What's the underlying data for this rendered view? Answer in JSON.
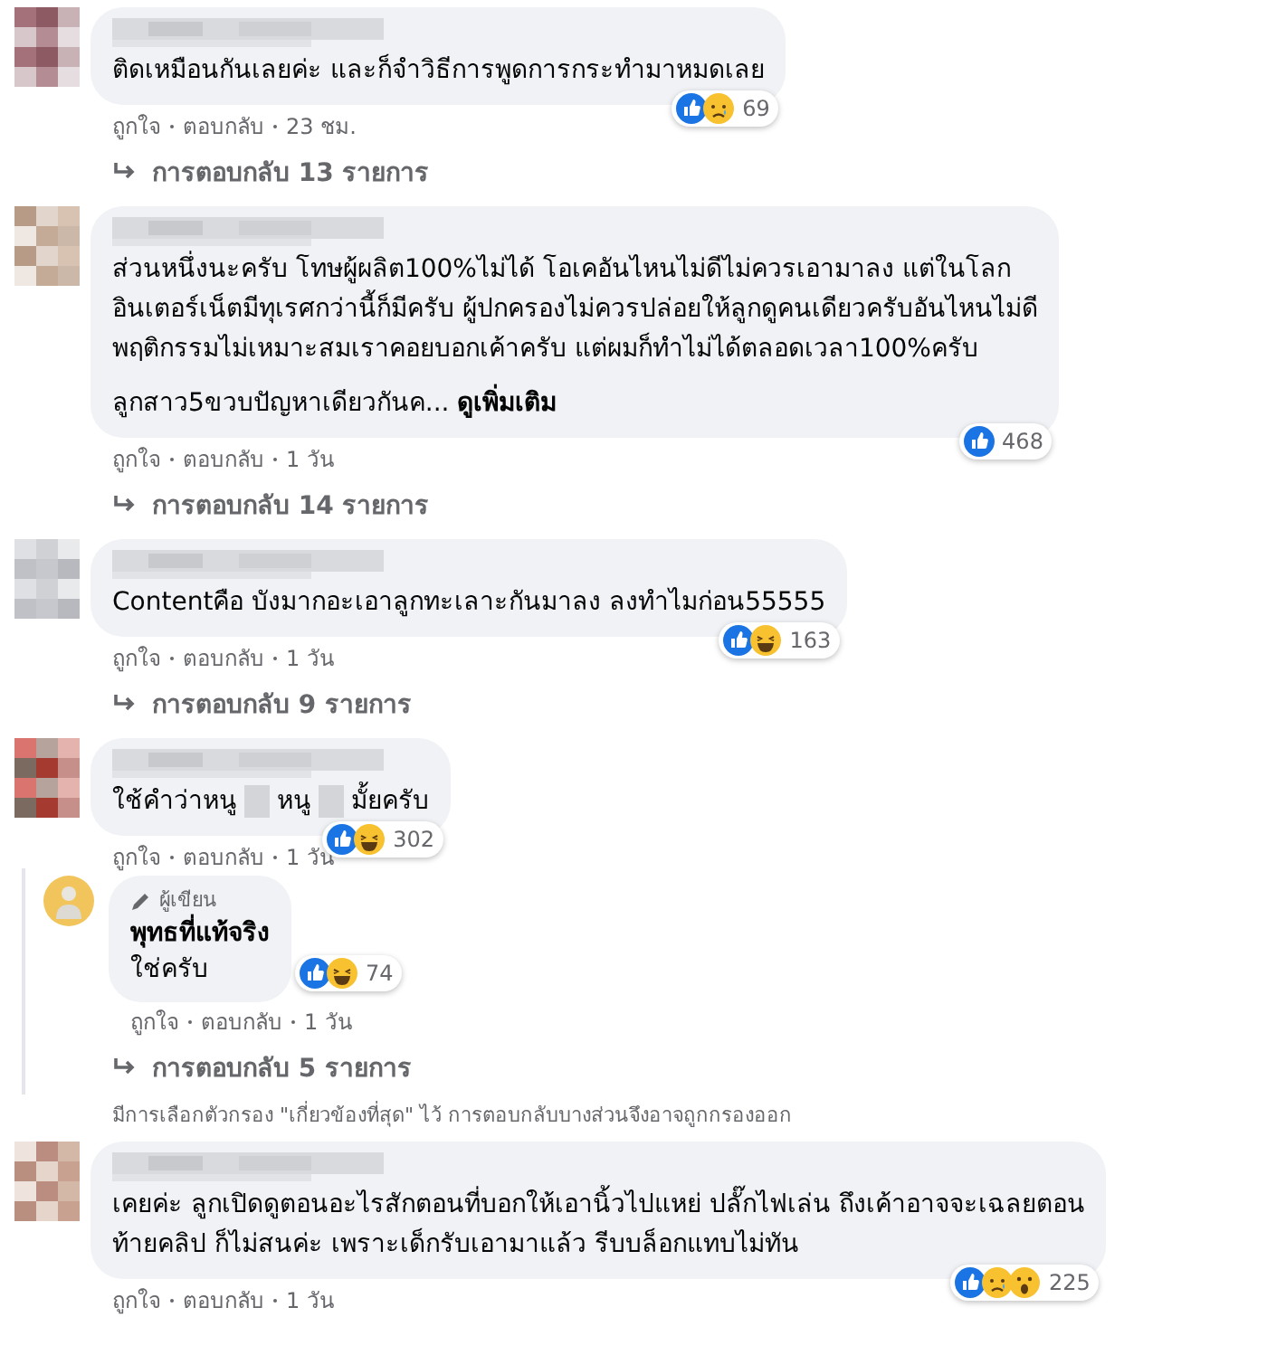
{
  "items": [
    {
      "kind": "comment",
      "paragraphs": [
        {
          "lines": [
            "ติดเหมือนกันเลยค่ะ และก็จำวิธีการพูดการกระทำมาหมดเลย"
          ]
        }
      ],
      "reactions": {
        "kinds": [
          {
            "kind": "like"
          },
          {
            "kind": "sad"
          }
        ],
        "count": "69"
      },
      "actions": [
        "ถูกใจ",
        "ตอบกลับ"
      ],
      "time": "23 ชม.",
      "replies_link": "การตอบกลับ 13 รายการ"
    },
    {
      "kind": "comment",
      "paragraphs": [
        {
          "lines": [
            "ส่วนหนึ่งนะครับ โทษผู้ผลิต100%ไม่ได้ โอเคอันไหนไม่ดีไม่ควรเอามาลง แต่ในโลก",
            "อินเตอร์เน็ตมีทุเรศกว่านี้ก็มีครับ ผู้ปกครองไม่ควรปล่อยให้ลูกดูคนเดียวครับอันไหนไม่ดี",
            "พฤติกรรมไม่เหมาะสมเราคอยบอกเค้าครับ แต่ผมก็ทำไม่ได้ตลอดเวลา100%ครับ"
          ]
        },
        {
          "lines": [
            "ลูกสาว5ขวบปัญหาเดียวกันค..."
          ],
          "see_more": "ดูเพิ่มเติม"
        }
      ],
      "reactions": {
        "kinds": [
          {
            "kind": "like"
          }
        ],
        "count": "468"
      },
      "actions": [
        "ถูกใจ",
        "ตอบกลับ"
      ],
      "time": "1 วัน",
      "replies_link": "การตอบกลับ 14 รายการ"
    },
    {
      "kind": "comment",
      "paragraphs": [
        {
          "lines": [
            "Contentคือ บังมากอะเอาลูกทะเลาะกันมาลง ลงทำไมก่อน55555"
          ]
        }
      ],
      "reactions": {
        "kinds": [
          {
            "kind": "like"
          },
          {
            "kind": "haha"
          }
        ],
        "count": "163"
      },
      "actions": [
        "ถูกใจ",
        "ตอบกลับ"
      ],
      "time": "1 วัน",
      "replies_link": "การตอบกลับ 9 รายการ"
    },
    {
      "kind": "comment",
      "segments": [
        {
          "kind": "text",
          "text": "ใช้คำว่าหนู"
        },
        {
          "kind": "redaction"
        },
        {
          "kind": "text",
          "text": "หนู"
        },
        {
          "kind": "redaction"
        },
        {
          "kind": "text",
          "text": "มั้ยครับ"
        }
      ],
      "reactions": {
        "kinds": [
          {
            "kind": "like"
          },
          {
            "kind": "haha"
          }
        ],
        "count": "302"
      },
      "actions": [
        "ถูกใจ",
        "ตอบกลับ"
      ],
      "time": "1 วัน",
      "reply": {
        "author_badge": "ผู้เขียน",
        "name": "พุทธที่แท้จริง",
        "text": "ใช่ครับ",
        "reactions": {
          "kinds": [
            {
              "kind": "like"
            },
            {
              "kind": "haha"
            }
          ],
          "count": "74"
        },
        "actions": [
          "ถูกใจ",
          "ตอบกลับ"
        ],
        "time": "1 วัน",
        "replies_link": "การตอบกลับ 5 รายการ"
      }
    },
    {
      "kind": "notice",
      "text": "มีการเลือกตัวกรอง \"เกี่ยวข้องที่สุด\" ไว้ การตอบกลับบางส่วนจึงอาจถูกกรองออก"
    },
    {
      "kind": "comment",
      "paragraphs": [
        {
          "lines": [
            "เคยค่ะ ลูกเปิดดูตอนอะไรสักตอนที่บอกให้เอานิ้วไปแหย่ ปลั๊กไฟเล่น ถึงเค้าอาจจะเฉลยตอน",
            "ท้ายคลิป ก็ไม่สนค่ะ เพราะเด็กรับเอามาแล้ว รีบบล็อกแทบไม่ทัน"
          ]
        }
      ],
      "reactions": {
        "kinds": [
          {
            "kind": "like"
          },
          {
            "kind": "sad"
          },
          {
            "kind": "wow"
          }
        ],
        "count": "225"
      },
      "actions": [
        "ถูกใจ",
        "ตอบกลับ"
      ],
      "time": "1 วัน"
    }
  ]
}
